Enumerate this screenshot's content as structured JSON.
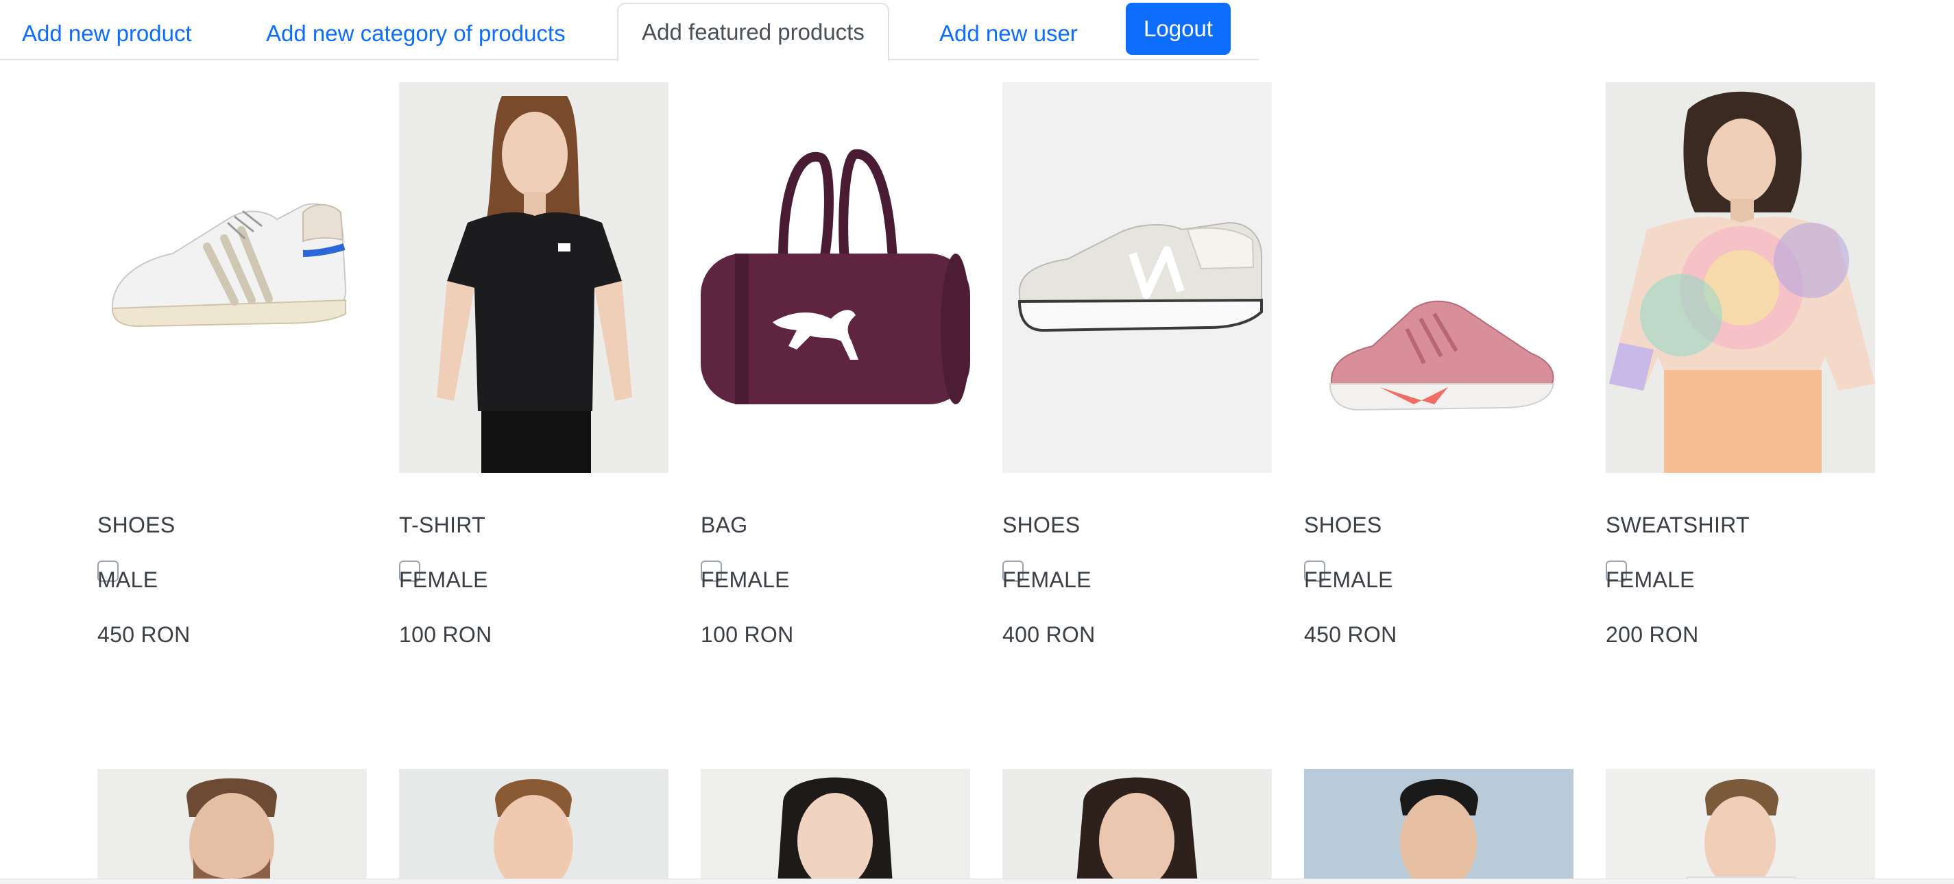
{
  "nav": {
    "tabs": [
      {
        "label": "Add new product",
        "active": false
      },
      {
        "label": "Add new category of products",
        "active": false
      },
      {
        "label": "Add featured products",
        "active": true
      },
      {
        "label": "Add new user",
        "active": false
      }
    ],
    "logout_label": "Logout"
  },
  "colors": {
    "link": "#0d6efd",
    "button_bg": "#0d6efd",
    "active_tab_text": "#495057"
  },
  "products": [
    {
      "category": "SHOES",
      "gender": "MALE",
      "price": "450 RON",
      "checked": false,
      "image": "white-high-top-sneaker"
    },
    {
      "category": "T-SHIRT",
      "gender": "FEMALE",
      "price": "100 RON",
      "checked": false,
      "image": "woman-black-tshirt"
    },
    {
      "category": "BAG",
      "gender": "FEMALE",
      "price": "100 RON",
      "checked": false,
      "image": "burgundy-duffel-bag"
    },
    {
      "category": "SHOES",
      "gender": "FEMALE",
      "price": "400 RON",
      "checked": false,
      "image": "grey-running-sneaker"
    },
    {
      "category": "SHOES",
      "gender": "FEMALE",
      "price": "450 RON",
      "checked": false,
      "image": "pink-running-sneaker"
    },
    {
      "category": "SWEATSHIRT",
      "gender": "FEMALE",
      "price": "200 RON",
      "checked": false,
      "image": "woman-tie-dye-sweatshirt"
    }
  ],
  "second_row_images": [
    "man-portrait-bearded",
    "man-portrait-green-shirt",
    "woman-portrait-dark-hair",
    "woman-portrait-long-hair",
    "man-portrait-blue-background",
    "man-portrait-white-tshirt"
  ]
}
